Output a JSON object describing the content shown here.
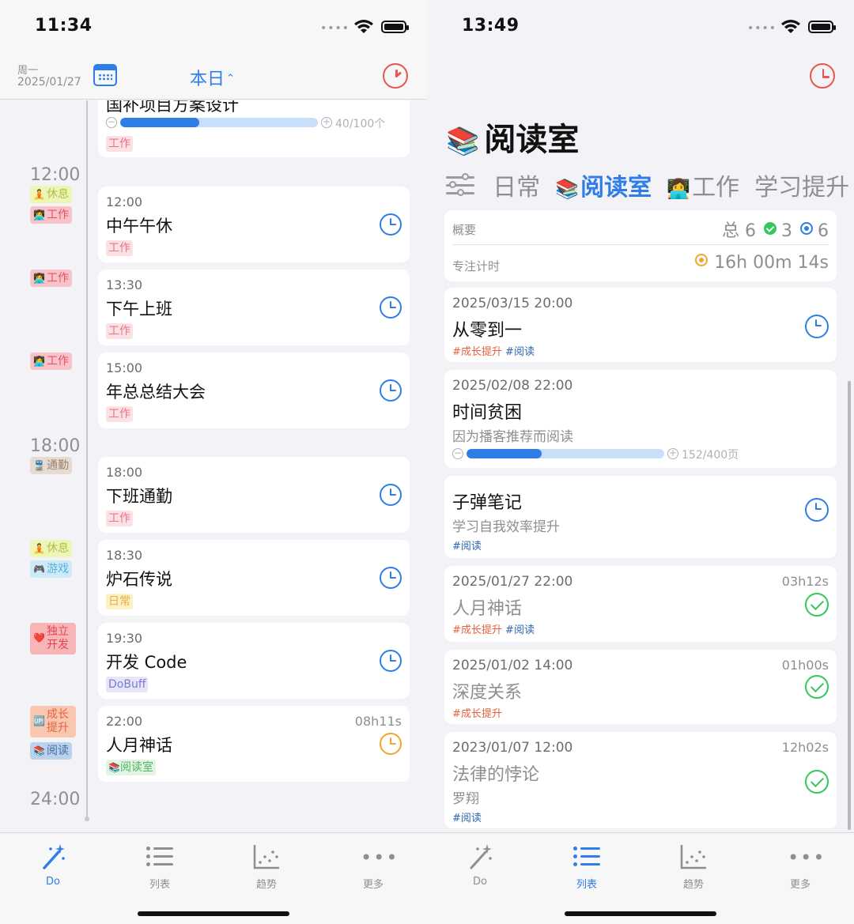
{
  "left": {
    "status": {
      "time": "11:34"
    },
    "header": {
      "weekday": "周一",
      "date": "2025/01/27",
      "range_label": "本日",
      "range_chevron": "⌃⌄"
    },
    "top_card": {
      "title_partial": "国补项目方案设计",
      "progress": {
        "current": 40,
        "total": 100,
        "fraction": 0.4,
        "label": "40/100个"
      },
      "tag": "工作"
    },
    "hours": [
      "12:00",
      "18:00",
      "24:00"
    ],
    "side_tags": [
      {
        "emoji": "🧘",
        "label": "休息"
      },
      {
        "emoji": "👩‍💻",
        "label": "工作"
      },
      {
        "emoji": "👩‍💻",
        "label": "工作"
      },
      {
        "emoji": "👩‍💻",
        "label": "工作"
      },
      {
        "emoji": "🚆",
        "label": "通勤"
      },
      {
        "emoji": "🧘",
        "label": "休息"
      },
      {
        "emoji": "🎮",
        "label": "游戏"
      },
      {
        "emoji": "❤️",
        "label1": "独立",
        "label2": "开发"
      },
      {
        "emoji": "🆙",
        "label1": "成长",
        "label2": "提升"
      },
      {
        "emoji": "📚",
        "label": "阅读"
      }
    ],
    "events": [
      {
        "time": "12:00",
        "title": "中午午休",
        "tag": "工作"
      },
      {
        "time": "13:30",
        "title": "下午上班",
        "tag": "工作"
      },
      {
        "time": "15:00",
        "title": "年总总结大会",
        "tag": "工作"
      },
      {
        "time": "18:00",
        "title": "下班通勤",
        "tag": "工作"
      },
      {
        "time": "18:30",
        "title": "炉石传说",
        "tag": "日常"
      },
      {
        "time": "19:30",
        "title": "开发 Code",
        "tag": "DoBuff"
      },
      {
        "time": "22:00",
        "title": "人月神话",
        "tag": "阅读室",
        "tag_emoji": "📚",
        "duration": "08h11s"
      }
    ],
    "tabbar": [
      {
        "label": "Do",
        "icon": "magic-wand-icon",
        "active": true
      },
      {
        "label": "列表",
        "icon": "list-icon",
        "active": false
      },
      {
        "label": "趋势",
        "icon": "scatter-chart-icon",
        "active": false
      },
      {
        "label": "更多",
        "icon": "more-icon",
        "active": false
      }
    ]
  },
  "right": {
    "status": {
      "time": "13:49"
    },
    "title": {
      "emoji": "📚",
      "text": "阅读室"
    },
    "segments": [
      {
        "emoji": "",
        "label": "日常"
      },
      {
        "emoji": "📚",
        "label": "阅读室",
        "active": true
      },
      {
        "emoji": "👩‍💻",
        "label": "工作"
      },
      {
        "emoji": "",
        "label": "学习提升"
      }
    ],
    "summary": {
      "overview_label": "概要",
      "total_label": "总",
      "total": "6",
      "done": "3",
      "target": "6",
      "focus_label": "专注计时",
      "focus_time": "16h 00m 14s"
    },
    "items": [
      {
        "date": "2025/03/15 20:00",
        "title": "从零到一",
        "tags": [
          "#成长提升",
          "#阅读"
        ]
      },
      {
        "date": "2025/02/08 22:00",
        "title": "时间贫困",
        "subtitle": "因为播客推荐而阅读",
        "progress": {
          "current": 152,
          "total": 400,
          "fraction": 0.38,
          "label": "152/400页"
        }
      },
      {
        "title": "子弹笔记",
        "subtitle": "学习自我效率提升",
        "tags": [
          "#阅读"
        ]
      },
      {
        "date": "2025/01/27 22:00",
        "duration": "03h12s",
        "title": "人月神话",
        "tags": [
          "#成长提升",
          "#阅读"
        ],
        "done": true
      },
      {
        "date": "2025/01/02 14:00",
        "duration": "01h00s",
        "title": "深度关系",
        "tags": [
          "#成长提升"
        ],
        "done": true
      },
      {
        "date": "2023/01/07 12:00",
        "duration": "12h02s",
        "title": "法律的悖论",
        "subtitle": "罗翔",
        "tags": [
          "#阅读"
        ],
        "done": true
      }
    ],
    "tabbar": [
      {
        "label": "Do",
        "icon": "magic-wand-icon",
        "active": false
      },
      {
        "label": "列表",
        "icon": "list-icon",
        "active": true
      },
      {
        "label": "趋势",
        "icon": "scatter-chart-icon",
        "active": false
      },
      {
        "label": "更多",
        "icon": "more-icon",
        "active": false
      }
    ]
  },
  "colors": {
    "accent": "#2f7ee8",
    "red": "#e5574f",
    "green": "#34c759",
    "orange": "#f3a52d"
  }
}
